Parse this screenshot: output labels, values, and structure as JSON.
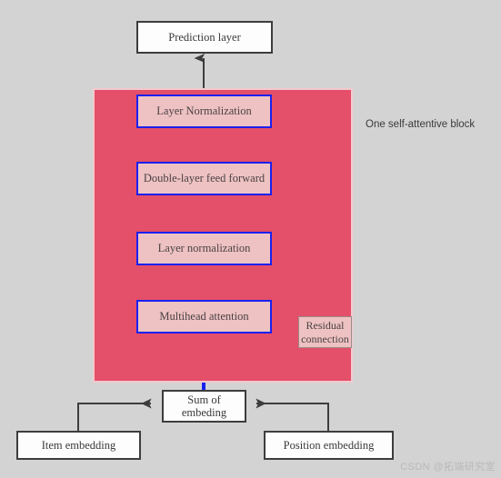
{
  "diagram": {
    "title_label": "One self-attentive block",
    "watermark": "CSDN @拓端研究室",
    "colors": {
      "canvas_bg": "#d3d3d3",
      "block_fill": "#e44f69",
      "block_border": "#f3c9cf",
      "inner_box_fill": "#eec2c2",
      "inner_box_border": "#1a21ef",
      "plain_box_fill": "#fdfdfd",
      "plain_box_border": "#3d3d3d",
      "arrow_blue": "#1a21ef",
      "arrow_dark": "#3d3d3d",
      "text": "#3a3a3a",
      "watermark": "#b9b9b9"
    },
    "nodes": {
      "prediction_layer": "Prediction layer",
      "layer_normalization_top": "Layer Normalization",
      "double_layer_feed_forward": "Double-layer feed forward",
      "layer_normalization_mid": "Layer normalization",
      "multihead_attention": "Multihead attention",
      "residual_connection_line1": "Residual",
      "residual_connection_line2": "connection",
      "sum_of_embedding_line1": "Sum of",
      "sum_of_embedding_line2": "embeding",
      "item_embedding": "Item embedding",
      "position_embedding": "Position embedding"
    },
    "edges": [
      {
        "name": "sum-to-multihead-attention",
        "from": "Sum of embeding",
        "to": "Multihead attention",
        "color": "#1a21ef"
      },
      {
        "name": "multihead-to-layer-normalization",
        "from": "Multihead attention",
        "to": "Layer normalization",
        "color": "#1a21ef"
      },
      {
        "name": "residual-bypass",
        "from": "Sum of embeding",
        "to": "Layer normalization",
        "color": "#1a21ef"
      },
      {
        "name": "layer-normalization-to-feed-forward",
        "from": "Layer normalization",
        "to": "Double-layer feed forward",
        "color": "#1a21ef"
      },
      {
        "name": "feed-forward-to-layer-normalization-top",
        "from": "Double-layer feed forward",
        "to": "Layer Normalization",
        "color": "#1a21ef"
      },
      {
        "name": "block-to-prediction-layer",
        "from": "Layer Normalization",
        "to": "Prediction layer",
        "color": "#3d3d3d"
      },
      {
        "name": "item-embedding-to-sum",
        "from": "Item embedding",
        "to": "Sum of embeding",
        "color": "#3d3d3d"
      },
      {
        "name": "position-embedding-to-sum",
        "from": "Position embedding",
        "to": "Sum of embeding",
        "color": "#3d3d3d"
      }
    ]
  }
}
